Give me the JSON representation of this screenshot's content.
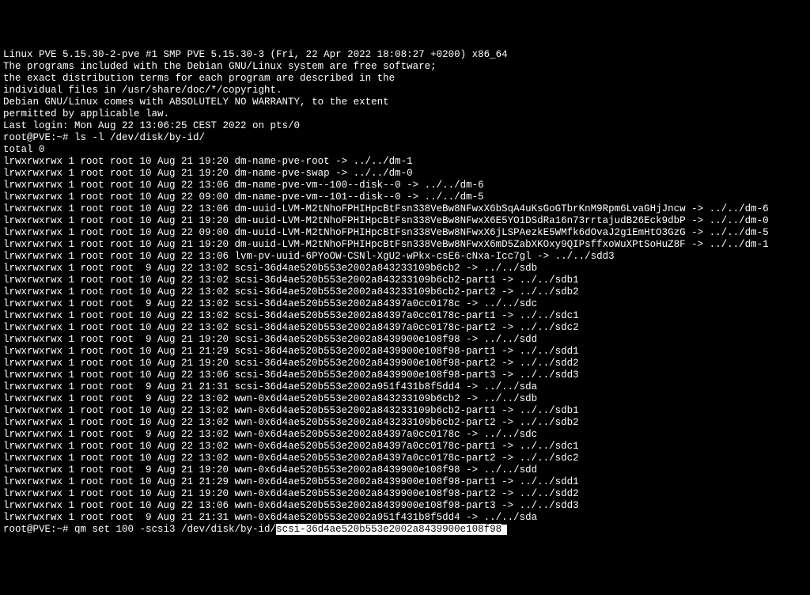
{
  "banner": {
    "kernel": "Linux PVE 5.15.30-2-pve #1 SMP PVE 5.15.30-3 (Fri, 22 Apr 2022 18:08:27 +0200) x86_64",
    "blank1": "",
    "msg1": "The programs included with the Debian GNU/Linux system are free software;",
    "msg2": "the exact distribution terms for each program are described in the",
    "msg3": "individual files in /usr/share/doc/*/copyright.",
    "blank2": "",
    "msg4": "Debian GNU/Linux comes with ABSOLUTELY NO WARRANTY, to the extent",
    "msg5": "permitted by applicable law.",
    "lastlogin": "Last login: Mon Aug 22 13:06:25 CEST 2022 on pts/0"
  },
  "prompt1": "root@PVE:~# ",
  "cmd1": "ls -l /dev/disk/by-id/",
  "total": "total 0",
  "listing": [
    "lrwxrwxrwx 1 root root 10 Aug 21 19:20 dm-name-pve-root -> ../../dm-1",
    "lrwxrwxrwx 1 root root 10 Aug 21 19:20 dm-name-pve-swap -> ../../dm-0",
    "lrwxrwxrwx 1 root root 10 Aug 22 13:06 dm-name-pve-vm--100--disk--0 -> ../../dm-6",
    "lrwxrwxrwx 1 root root 10 Aug 22 09:00 dm-name-pve-vm--101--disk--0 -> ../../dm-5",
    "lrwxrwxrwx 1 root root 10 Aug 22 13:06 dm-uuid-LVM-M2tNhoFPHIHpcBtFsn338VeBw8NFwxX6bSqA4uKsGoGTbrKnM9Rpm6LvaGHjJncw -> ../../dm-6",
    "lrwxrwxrwx 1 root root 10 Aug 21 19:20 dm-uuid-LVM-M2tNhoFPHIHpcBtFsn338VeBw8NFwxX6E5YO1DSdRa16n73rrtajudB26Eck9dbP -> ../../dm-0",
    "lrwxrwxrwx 1 root root 10 Aug 22 09:00 dm-uuid-LVM-M2tNhoFPHIHpcBtFsn338VeBw8NFwxX6jLSPAezkE5WMfk6dOvaJ2g1EmHtO3GzG -> ../../dm-5",
    "lrwxrwxrwx 1 root root 10 Aug 21 19:20 dm-uuid-LVM-M2tNhoFPHIHpcBtFsn338VeBw8NFwxX6mD5ZabXKOxy9QIPsffxoWuXPtSoHuZ8F -> ../../dm-1",
    "lrwxrwxrwx 1 root root 10 Aug 22 13:06 lvm-pv-uuid-6PYoOW-CSNl-XgU2-wPkx-csE6-cNxa-Icc7gl -> ../../sdd3",
    "lrwxrwxrwx 1 root root  9 Aug 22 13:02 scsi-36d4ae520b553e2002a843233109b6cb2 -> ../../sdb",
    "lrwxrwxrwx 1 root root 10 Aug 22 13:02 scsi-36d4ae520b553e2002a843233109b6cb2-part1 -> ../../sdb1",
    "lrwxrwxrwx 1 root root 10 Aug 22 13:02 scsi-36d4ae520b553e2002a843233109b6cb2-part2 -> ../../sdb2",
    "lrwxrwxrwx 1 root root  9 Aug 22 13:02 scsi-36d4ae520b553e2002a84397a0cc0178c -> ../../sdc",
    "lrwxrwxrwx 1 root root 10 Aug 22 13:02 scsi-36d4ae520b553e2002a84397a0cc0178c-part1 -> ../../sdc1",
    "lrwxrwxrwx 1 root root 10 Aug 22 13:02 scsi-36d4ae520b553e2002a84397a0cc0178c-part2 -> ../../sdc2",
    "lrwxrwxrwx 1 root root  9 Aug 21 19:20 scsi-36d4ae520b553e2002a8439900e108f98 -> ../../sdd",
    "lrwxrwxrwx 1 root root 10 Aug 21 21:29 scsi-36d4ae520b553e2002a8439900e108f98-part1 -> ../../sdd1",
    "lrwxrwxrwx 1 root root 10 Aug 21 19:20 scsi-36d4ae520b553e2002a8439900e108f98-part2 -> ../../sdd2",
    "lrwxrwxrwx 1 root root 10 Aug 22 13:06 scsi-36d4ae520b553e2002a8439900e108f98-part3 -> ../../sdd3",
    "lrwxrwxrwx 1 root root  9 Aug 21 21:31 scsi-36d4ae520b553e2002a951f431b8f5dd4 -> ../../sda",
    "lrwxrwxrwx 1 root root  9 Aug 22 13:02 wwn-0x6d4ae520b553e2002a843233109b6cb2 -> ../../sdb",
    "lrwxrwxrwx 1 root root 10 Aug 22 13:02 wwn-0x6d4ae520b553e2002a843233109b6cb2-part1 -> ../../sdb1",
    "lrwxrwxrwx 1 root root 10 Aug 22 13:02 wwn-0x6d4ae520b553e2002a843233109b6cb2-part2 -> ../../sdb2",
    "lrwxrwxrwx 1 root root  9 Aug 22 13:02 wwn-0x6d4ae520b553e2002a84397a0cc0178c -> ../../sdc",
    "lrwxrwxrwx 1 root root 10 Aug 22 13:02 wwn-0x6d4ae520b553e2002a84397a0cc0178c-part1 -> ../../sdc1",
    "lrwxrwxrwx 1 root root 10 Aug 22 13:02 wwn-0x6d4ae520b553e2002a84397a0cc0178c-part2 -> ../../sdc2",
    "lrwxrwxrwx 1 root root  9 Aug 21 19:20 wwn-0x6d4ae520b553e2002a8439900e108f98 -> ../../sdd",
    "lrwxrwxrwx 1 root root 10 Aug 21 21:29 wwn-0x6d4ae520b553e2002a8439900e108f98-part1 -> ../../sdd1",
    "lrwxrwxrwx 1 root root 10 Aug 21 19:20 wwn-0x6d4ae520b553e2002a8439900e108f98-part2 -> ../../sdd2",
    "lrwxrwxrwx 1 root root 10 Aug 22 13:06 wwn-0x6d4ae520b553e2002a8439900e108f98-part3 -> ../../sdd3",
    "lrwxrwxrwx 1 root root  9 Aug 21 21:31 wwn-0x6d4ae520b553e2002a951f431b8f5dd4 -> ../../sda"
  ],
  "prompt2": "root@PVE:~# ",
  "cmd2_before": "qm set 100 -scsi3 /dev/disk/by-id/",
  "cmd2_highlight": "scsi-36d4ae520b553e2002a8439900e108f98"
}
